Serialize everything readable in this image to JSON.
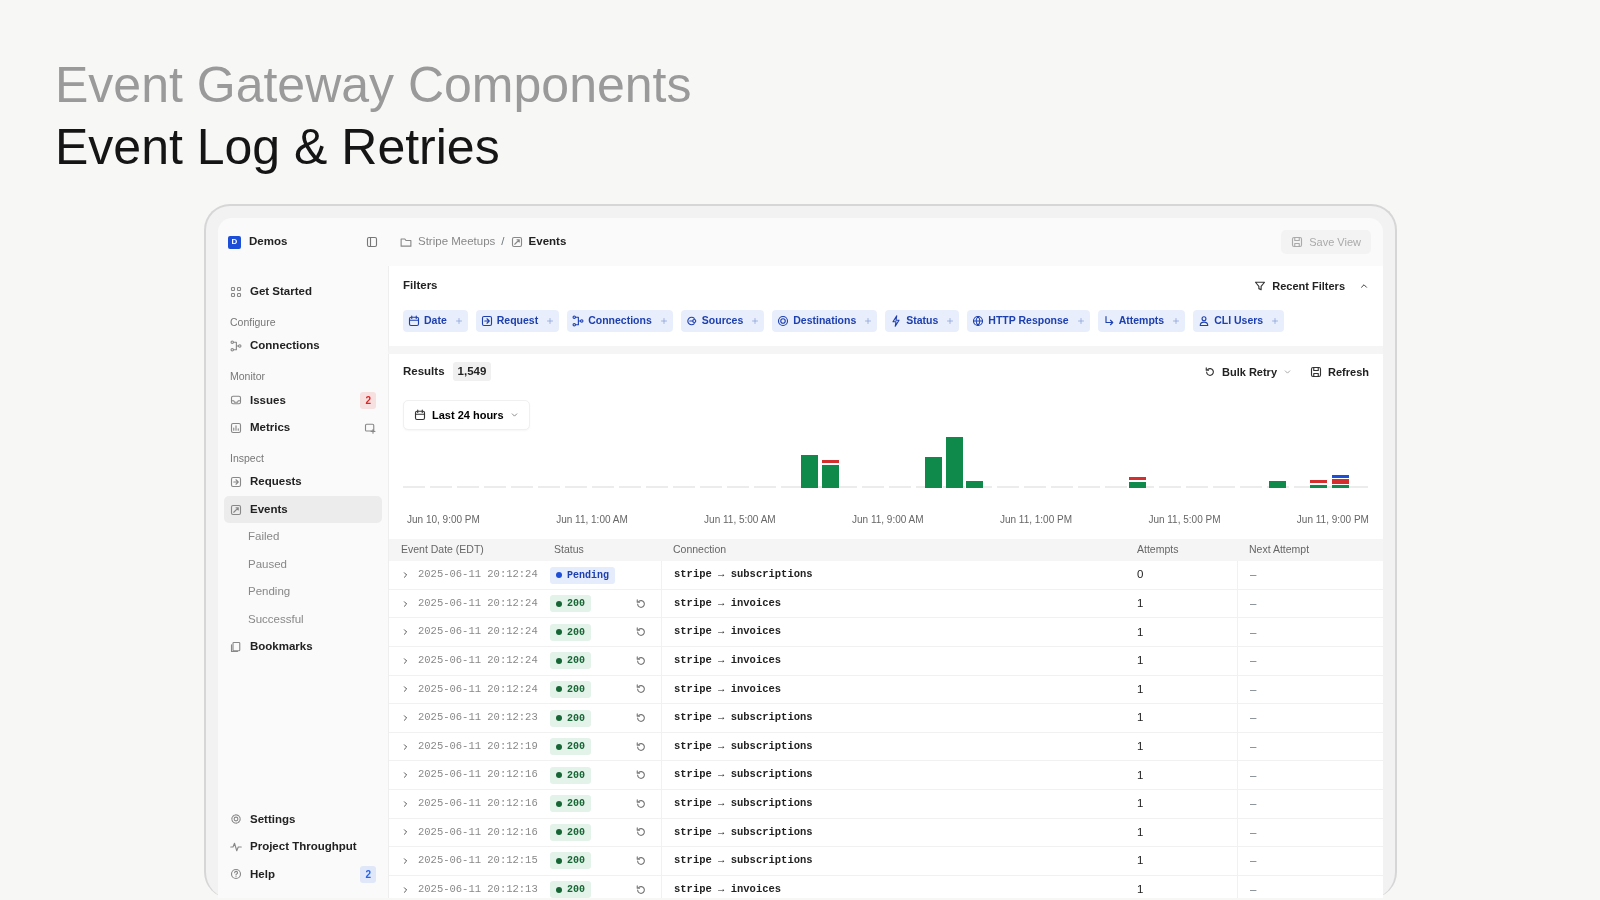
{
  "heading": {
    "title": "Event Gateway Components",
    "subtitle": "Event Log & Retries"
  },
  "workspace": {
    "initial": "D",
    "name": "Demos"
  },
  "breadcrumb_separator": "/",
  "breadcrumbs": [
    {
      "label": "Stripe Meetups",
      "kind": "folder"
    },
    {
      "label": "Events",
      "kind": "events"
    }
  ],
  "save_view": "Save View",
  "sidebar": {
    "items": [
      {
        "kind": "item",
        "label": "Get Started",
        "selected": false
      },
      {
        "kind": "section",
        "label": "Configure"
      },
      {
        "kind": "item",
        "label": "Connections",
        "selected": false
      },
      {
        "kind": "section",
        "label": "Monitor"
      },
      {
        "kind": "item",
        "label": "Issues",
        "selected": false,
        "badge": "2",
        "color": "#dc2626"
      },
      {
        "kind": "item",
        "label": "Metrics",
        "selected": false
      },
      {
        "kind": "section",
        "label": "Inspect"
      },
      {
        "kind": "item",
        "label": "Requests",
        "selected": false
      },
      {
        "kind": "item",
        "label": "Events",
        "selected": true,
        "children": [
          {
            "label": "Failed",
            "selected": false
          },
          {
            "label": "Paused",
            "selected": false
          },
          {
            "label": "Pending",
            "selected": false
          },
          {
            "label": "Successful",
            "selected": false
          }
        ]
      },
      {
        "kind": "item",
        "label": "Bookmarks",
        "selected": false
      }
    ],
    "bottom": [
      {
        "label": "Settings"
      },
      {
        "label": "Project Throughput"
      },
      {
        "label": "Help",
        "badge": "2",
        "color": "#2563eb"
      }
    ]
  },
  "filters": {
    "title": "Filters",
    "recent": "Recent Filters",
    "expanded": true,
    "chips": [
      {
        "label": "Date"
      },
      {
        "label": "Request"
      },
      {
        "label": "Connections"
      },
      {
        "label": "Sources"
      },
      {
        "label": "Destinations"
      },
      {
        "label": "Status"
      },
      {
        "label": "HTTP Response"
      },
      {
        "label": "Attempts"
      },
      {
        "label": "CLI Users"
      }
    ]
  },
  "results": {
    "label": "Results",
    "count": "1,549",
    "bulk_retry": "Bulk Retry",
    "refresh": "Refresh",
    "range": "Last 24 hours"
  },
  "histogram": {
    "x_labels": [
      "Jun 10, 9:00 PM",
      "Jun 11, 1:00 AM",
      "Jun 11, 5:00 AM",
      "Jun 11, 9:00 AM",
      "Jun 11, 1:00 PM",
      "Jun 11, 5:00 PM",
      "Jun 11, 9:00 PM"
    ]
  },
  "table": {
    "columns": [
      "Event Date (EDT)",
      "Status",
      "Connection",
      "Attempts",
      "Next Attempt"
    ],
    "rows": [
      {
        "date": "2025-06-11 20:12:24",
        "status": "Pending",
        "kind": "pending",
        "connection": "stripe → subscriptions",
        "attempts": "0",
        "next": "–"
      },
      {
        "date": "2025-06-11 20:12:24",
        "status": "200",
        "kind": "success",
        "connection": "stripe → invoices",
        "attempts": "1",
        "next": "–"
      },
      {
        "date": "2025-06-11 20:12:24",
        "status": "200",
        "kind": "success",
        "connection": "stripe → invoices",
        "attempts": "1",
        "next": "–"
      },
      {
        "date": "2025-06-11 20:12:24",
        "status": "200",
        "kind": "success",
        "connection": "stripe → invoices",
        "attempts": "1",
        "next": "–"
      },
      {
        "date": "2025-06-11 20:12:24",
        "status": "200",
        "kind": "success",
        "connection": "stripe → invoices",
        "attempts": "1",
        "next": "–"
      },
      {
        "date": "2025-06-11 20:12:23",
        "status": "200",
        "kind": "success",
        "connection": "stripe → subscriptions",
        "attempts": "1",
        "next": "–"
      },
      {
        "date": "2025-06-11 20:12:19",
        "status": "200",
        "kind": "success",
        "connection": "stripe → subscriptions",
        "attempts": "1",
        "next": "–"
      },
      {
        "date": "2025-06-11 20:12:16",
        "status": "200",
        "kind": "success",
        "connection": "stripe → subscriptions",
        "attempts": "1",
        "next": "–"
      },
      {
        "date": "2025-06-11 20:12:16",
        "status": "200",
        "kind": "success",
        "connection": "stripe → subscriptions",
        "attempts": "1",
        "next": "–"
      },
      {
        "date": "2025-06-11 20:12:16",
        "status": "200",
        "kind": "success",
        "connection": "stripe → subscriptions",
        "attempts": "1",
        "next": "–"
      },
      {
        "date": "2025-06-11 20:12:15",
        "status": "200",
        "kind": "success",
        "connection": "stripe → subscriptions",
        "attempts": "1",
        "next": "–"
      },
      {
        "date": "2025-06-11 20:12:13",
        "status": "200",
        "kind": "success",
        "connection": "stripe → invoices",
        "attempts": "1",
        "next": "–"
      }
    ]
  }
}
